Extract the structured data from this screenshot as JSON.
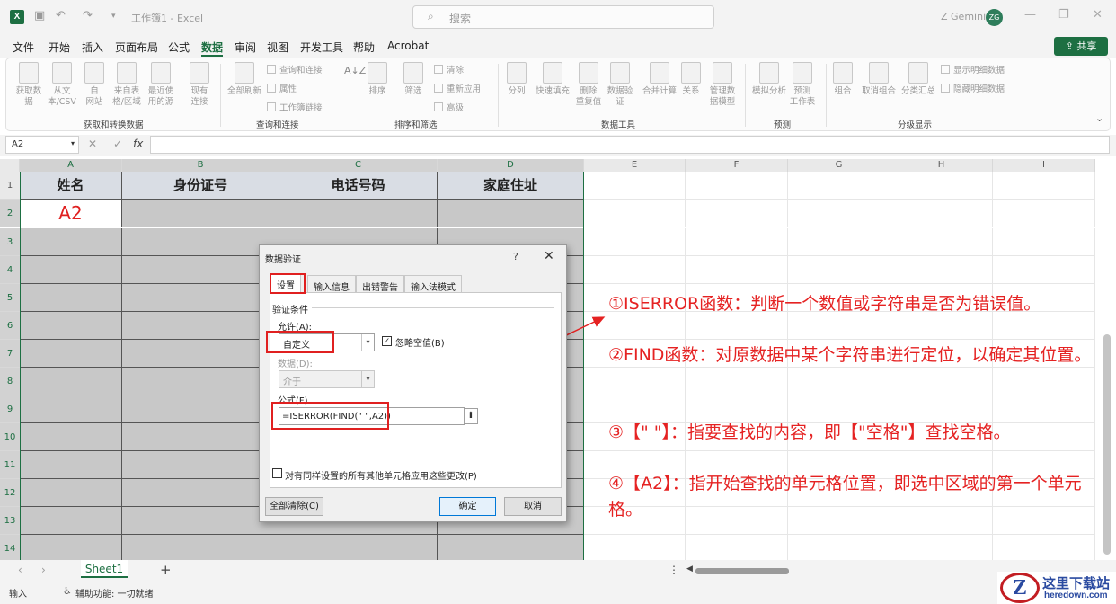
{
  "window": {
    "title": "工作簿1 - Excel",
    "search_placeholder": "搜索",
    "user_name": "Z Gemini",
    "user_initials": "ZG"
  },
  "menu": {
    "items": [
      "文件",
      "开始",
      "插入",
      "页面布局",
      "公式",
      "数据",
      "审阅",
      "视图",
      "开发工具",
      "帮助",
      "Acrobat"
    ],
    "active": "数据",
    "share": "共享"
  },
  "ribbon": {
    "group1": {
      "label": "获取和转换数据",
      "buttons": [
        "获取数\n据",
        "从文\n本/CSV",
        "自\n网站",
        "来自表\n格/区域",
        "最近使\n用的源",
        "现有\n连接"
      ]
    },
    "group2": {
      "label": "查询和连接",
      "big": "全部刷新",
      "small": [
        "查询和连接",
        "属性",
        "工作簿链接"
      ]
    },
    "group3": {
      "label": "排序和筛选",
      "sort": "排序",
      "filter": "筛选",
      "small": [
        "清除",
        "重新应用",
        "高级"
      ]
    },
    "group4": {
      "label": "数据工具",
      "buttons": [
        "分列",
        "快速填充",
        "删除\n重复值",
        "数据验\n证",
        "合并计算",
        "关系",
        "管理数\n据模型"
      ]
    },
    "group5": {
      "label": "预测",
      "buttons": [
        "模拟分析",
        "预测\n工作表"
      ]
    },
    "group6": {
      "label": "分级显示",
      "buttons": [
        "组合",
        "取消组合",
        "分类汇总"
      ],
      "small": [
        "显示明细数据",
        "隐藏明细数据"
      ]
    }
  },
  "formula_bar": {
    "name_box": "A2",
    "fx": "fx",
    "value": ""
  },
  "grid": {
    "columns": [
      "A",
      "B",
      "C",
      "D",
      "E",
      "F",
      "G",
      "H",
      "I"
    ],
    "rows": [
      "1",
      "2",
      "3",
      "4",
      "5",
      "6",
      "7",
      "8",
      "9",
      "10",
      "11",
      "12",
      "13",
      "14"
    ],
    "headers": [
      "姓名",
      "身份证号",
      "电话号码",
      "家庭住址"
    ],
    "a2_text": "A2"
  },
  "dialog": {
    "title": "数据验证",
    "help": "?",
    "close": "✕",
    "tabs": [
      "设置",
      "输入信息",
      "出错警告",
      "输入法模式"
    ],
    "section": "验证条件",
    "allow_label": "允许(A):",
    "allow_value": "自定义",
    "ignore_blank": "忽略空值(B)",
    "data_label": "数据(D):",
    "data_value": "介于",
    "formula_label": "公式(F)",
    "formula_value": "=ISERROR(FIND(\" \",A2))",
    "apply_all": "对有同样设置的所有其他单元格应用这些更改(P)",
    "clear_all": "全部清除(C)",
    "ok": "确定",
    "cancel": "取消"
  },
  "notes": [
    "①ISERROR函数：判断一个数值或字符串是否为错误值。",
    "②FIND函数：对原数据中某个字符串进行定位，以确定其位置。",
    "③【\" \"】：指要查找的内容，即【\"空格\"】查找空格。",
    "④【A2】：指开始查找的单元格位置，即选中区域的第一个单元格。"
  ],
  "sheets": {
    "active": "Sheet1",
    "add": "+"
  },
  "status": {
    "mode": "输入",
    "accessibility": "辅助功能: 一切就绪"
  },
  "watermark": {
    "logo": "Z",
    "name": "这里下载站",
    "domain": "heredown.com"
  },
  "colors": {
    "accent": "#1d6f42",
    "annotation": "#e52222",
    "header_fill": "#d9dde4",
    "range_fill": "#c8c8c8"
  }
}
